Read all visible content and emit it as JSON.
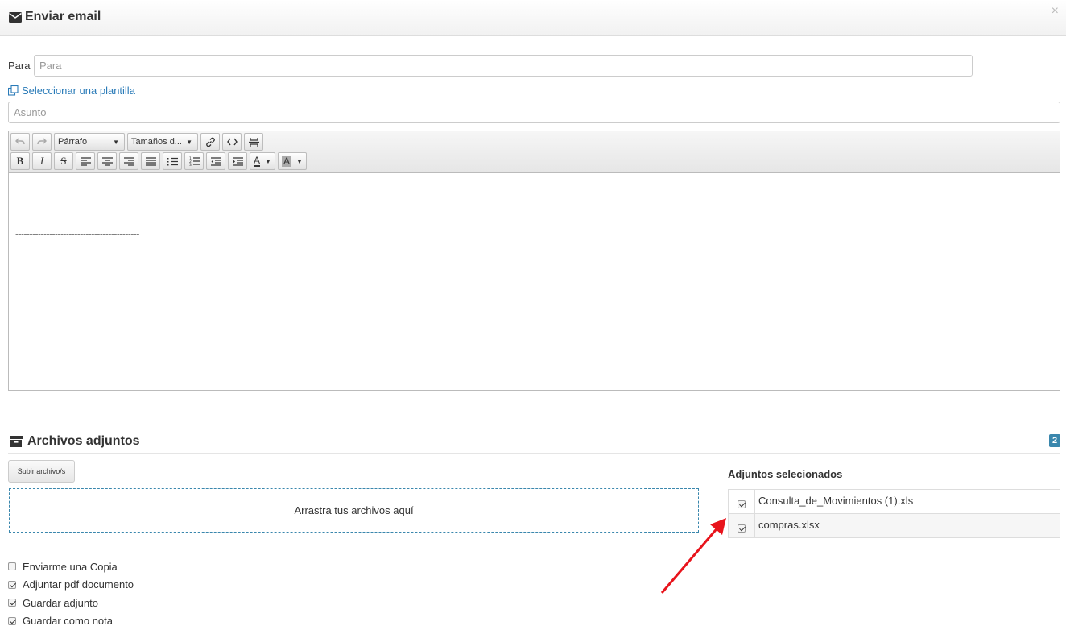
{
  "header": {
    "title": "Enviar email",
    "close": "×"
  },
  "to": {
    "label": "Para",
    "placeholder": "Para"
  },
  "template_link": "Seleccionar una plantilla",
  "subject": {
    "placeholder": "Asunto"
  },
  "toolbar": {
    "paragraph_select": "Párrafo",
    "size_select": "Tamaños d...",
    "buttons_row1": [
      "undo-icon",
      "redo-icon",
      "link-icon",
      "code-icon",
      "page-break-icon"
    ],
    "buttons_row2": [
      "bold-icon",
      "italic-icon",
      "strikethrough-icon",
      "align-left-icon",
      "align-center-icon",
      "align-right-icon",
      "justify-icon",
      "bullet-list-icon",
      "numbered-list-icon",
      "outdent-icon",
      "indent-icon",
      "text-color-icon",
      "background-color-icon"
    ],
    "bold": "B",
    "italic": "I",
    "strike": "S",
    "font_color": "A",
    "bg_color": "A"
  },
  "editor": {
    "content": "--------------------------------------------"
  },
  "attachments": {
    "title": "Archivos adjuntos",
    "count": "2",
    "upload_button": "Subir archivo/s",
    "dropzone": "Arrastra tus archivos aquí",
    "selected_title": "Adjuntos selecionados",
    "files": [
      {
        "name": "Consulta_de_Movimientos (1).xls",
        "checked": true
      },
      {
        "name": "compras.xlsx",
        "checked": true
      }
    ]
  },
  "options": [
    {
      "label": "Enviarme una Copia",
      "checked": false
    },
    {
      "label": "Adjuntar pdf documento",
      "checked": true
    },
    {
      "label": "Guardar adjunto",
      "checked": true
    },
    {
      "label": "Guardar como nota",
      "checked": true
    }
  ],
  "colors": {
    "link": "#2a7bb8",
    "badge": "#3a87ad",
    "arrow": "#e8141c"
  }
}
